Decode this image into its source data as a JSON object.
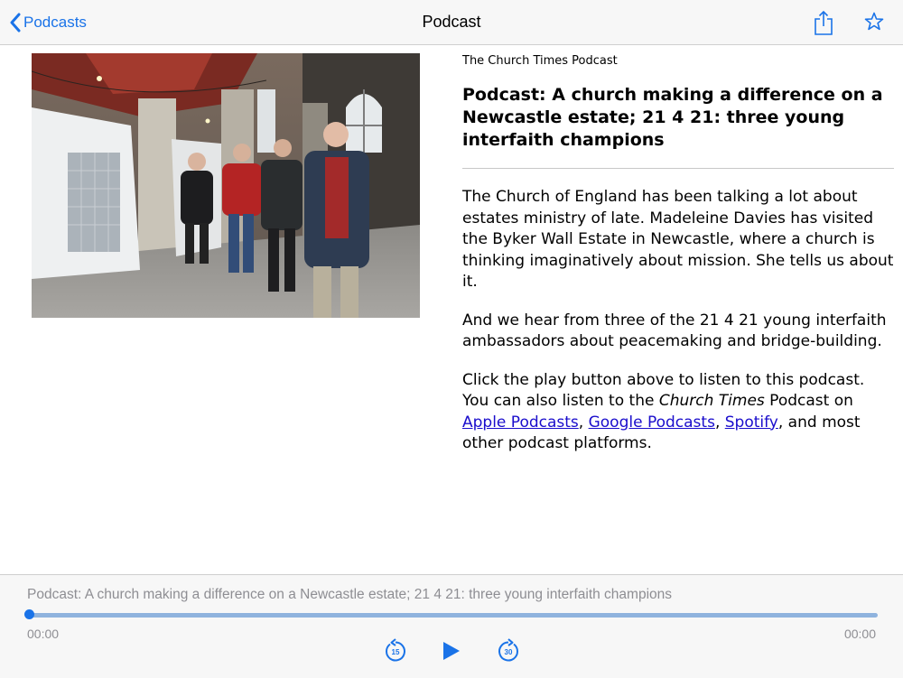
{
  "nav": {
    "back_label": "Podcasts",
    "title": "Podcast",
    "share_icon": "share-icon",
    "star_icon": "star-icon"
  },
  "article": {
    "source": "The Church Times Podcast",
    "headline": "Podcast: A church making a difference on a Newcastle estate; 21 4 21: three young interfaith champions",
    "paragraph1": "The Church of England has been talking a lot about estates ministry of late. Madeleine Davies has visited the Byker Wall Estate in Newcastle, where a church is thinking imaginatively about mission. She tells us about it.",
    "paragraph2": "And we hear from three of the 21 4 21 young interfaith ambassadors about peacemaking and bridge-building.",
    "paragraph3": {
      "text_before": "Click the play button above to listen to this podcast. You can also listen to the ",
      "italic": "Church Times",
      "text_mid": " Podcast on ",
      "link1": "Apple Podcasts",
      "sep1": ", ",
      "link2": "Google Podcasts",
      "sep2": ", ",
      "link3": "Spotify",
      "text_after": ", and most other podcast platforms."
    }
  },
  "player": {
    "title": "Podcast: A church making a difference on a Newcastle estate; 21 4 21: three young interfaith champions",
    "elapsed": "00:00",
    "remaining": "00:00",
    "progress": 0,
    "skip_back_seconds": "15",
    "skip_forward_seconds": "30"
  },
  "colors": {
    "accent": "#1a73e8",
    "link": "#1a0dcc",
    "muted": "#8e8e93",
    "track": "#8fb3de"
  }
}
